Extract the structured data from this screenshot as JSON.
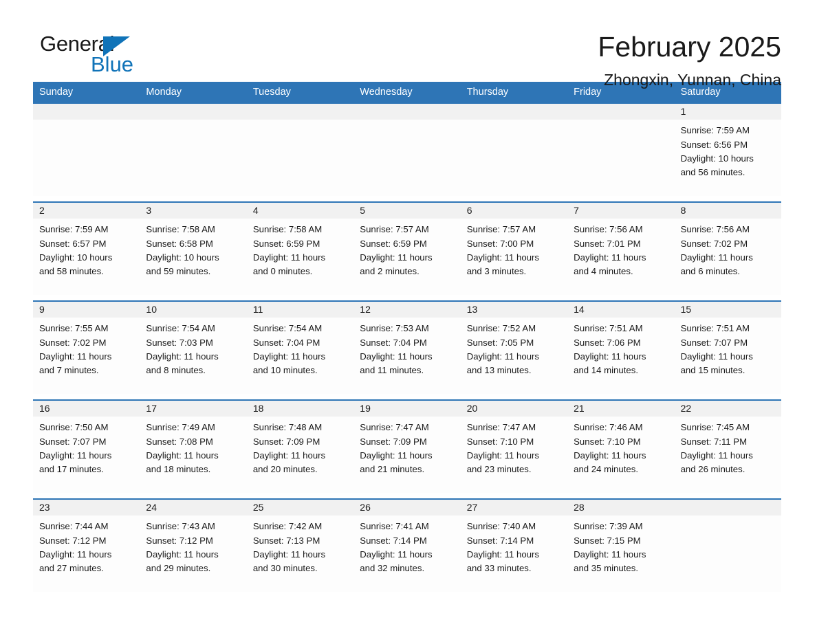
{
  "brand": {
    "name_part1": "General",
    "name_part2": "Blue",
    "accent_color": "#1073b8"
  },
  "header": {
    "month_title": "February 2025",
    "location": "Zhongxin, Yunnan, China"
  },
  "calendar": {
    "header_color": "#2e75b6",
    "weekdays": [
      "Sunday",
      "Monday",
      "Tuesday",
      "Wednesday",
      "Thursday",
      "Friday",
      "Saturday"
    ],
    "weeks": [
      [
        {
          "day": "",
          "lines": []
        },
        {
          "day": "",
          "lines": []
        },
        {
          "day": "",
          "lines": []
        },
        {
          "day": "",
          "lines": []
        },
        {
          "day": "",
          "lines": []
        },
        {
          "day": "",
          "lines": []
        },
        {
          "day": "1",
          "lines": [
            "Sunrise: 7:59 AM",
            "Sunset: 6:56 PM",
            "Daylight: 10 hours",
            "and 56 minutes."
          ]
        }
      ],
      [
        {
          "day": "2",
          "lines": [
            "Sunrise: 7:59 AM",
            "Sunset: 6:57 PM",
            "Daylight: 10 hours",
            "and 58 minutes."
          ]
        },
        {
          "day": "3",
          "lines": [
            "Sunrise: 7:58 AM",
            "Sunset: 6:58 PM",
            "Daylight: 10 hours",
            "and 59 minutes."
          ]
        },
        {
          "day": "4",
          "lines": [
            "Sunrise: 7:58 AM",
            "Sunset: 6:59 PM",
            "Daylight: 11 hours",
            "and 0 minutes."
          ]
        },
        {
          "day": "5",
          "lines": [
            "Sunrise: 7:57 AM",
            "Sunset: 6:59 PM",
            "Daylight: 11 hours",
            "and 2 minutes."
          ]
        },
        {
          "day": "6",
          "lines": [
            "Sunrise: 7:57 AM",
            "Sunset: 7:00 PM",
            "Daylight: 11 hours",
            "and 3 minutes."
          ]
        },
        {
          "day": "7",
          "lines": [
            "Sunrise: 7:56 AM",
            "Sunset: 7:01 PM",
            "Daylight: 11 hours",
            "and 4 minutes."
          ]
        },
        {
          "day": "8",
          "lines": [
            "Sunrise: 7:56 AM",
            "Sunset: 7:02 PM",
            "Daylight: 11 hours",
            "and 6 minutes."
          ]
        }
      ],
      [
        {
          "day": "9",
          "lines": [
            "Sunrise: 7:55 AM",
            "Sunset: 7:02 PM",
            "Daylight: 11 hours",
            "and 7 minutes."
          ]
        },
        {
          "day": "10",
          "lines": [
            "Sunrise: 7:54 AM",
            "Sunset: 7:03 PM",
            "Daylight: 11 hours",
            "and 8 minutes."
          ]
        },
        {
          "day": "11",
          "lines": [
            "Sunrise: 7:54 AM",
            "Sunset: 7:04 PM",
            "Daylight: 11 hours",
            "and 10 minutes."
          ]
        },
        {
          "day": "12",
          "lines": [
            "Sunrise: 7:53 AM",
            "Sunset: 7:04 PM",
            "Daylight: 11 hours",
            "and 11 minutes."
          ]
        },
        {
          "day": "13",
          "lines": [
            "Sunrise: 7:52 AM",
            "Sunset: 7:05 PM",
            "Daylight: 11 hours",
            "and 13 minutes."
          ]
        },
        {
          "day": "14",
          "lines": [
            "Sunrise: 7:51 AM",
            "Sunset: 7:06 PM",
            "Daylight: 11 hours",
            "and 14 minutes."
          ]
        },
        {
          "day": "15",
          "lines": [
            "Sunrise: 7:51 AM",
            "Sunset: 7:07 PM",
            "Daylight: 11 hours",
            "and 15 minutes."
          ]
        }
      ],
      [
        {
          "day": "16",
          "lines": [
            "Sunrise: 7:50 AM",
            "Sunset: 7:07 PM",
            "Daylight: 11 hours",
            "and 17 minutes."
          ]
        },
        {
          "day": "17",
          "lines": [
            "Sunrise: 7:49 AM",
            "Sunset: 7:08 PM",
            "Daylight: 11 hours",
            "and 18 minutes."
          ]
        },
        {
          "day": "18",
          "lines": [
            "Sunrise: 7:48 AM",
            "Sunset: 7:09 PM",
            "Daylight: 11 hours",
            "and 20 minutes."
          ]
        },
        {
          "day": "19",
          "lines": [
            "Sunrise: 7:47 AM",
            "Sunset: 7:09 PM",
            "Daylight: 11 hours",
            "and 21 minutes."
          ]
        },
        {
          "day": "20",
          "lines": [
            "Sunrise: 7:47 AM",
            "Sunset: 7:10 PM",
            "Daylight: 11 hours",
            "and 23 minutes."
          ]
        },
        {
          "day": "21",
          "lines": [
            "Sunrise: 7:46 AM",
            "Sunset: 7:10 PM",
            "Daylight: 11 hours",
            "and 24 minutes."
          ]
        },
        {
          "day": "22",
          "lines": [
            "Sunrise: 7:45 AM",
            "Sunset: 7:11 PM",
            "Daylight: 11 hours",
            "and 26 minutes."
          ]
        }
      ],
      [
        {
          "day": "23",
          "lines": [
            "Sunrise: 7:44 AM",
            "Sunset: 7:12 PM",
            "Daylight: 11 hours",
            "and 27 minutes."
          ]
        },
        {
          "day": "24",
          "lines": [
            "Sunrise: 7:43 AM",
            "Sunset: 7:12 PM",
            "Daylight: 11 hours",
            "and 29 minutes."
          ]
        },
        {
          "day": "25",
          "lines": [
            "Sunrise: 7:42 AM",
            "Sunset: 7:13 PM",
            "Daylight: 11 hours",
            "and 30 minutes."
          ]
        },
        {
          "day": "26",
          "lines": [
            "Sunrise: 7:41 AM",
            "Sunset: 7:14 PM",
            "Daylight: 11 hours",
            "and 32 minutes."
          ]
        },
        {
          "day": "27",
          "lines": [
            "Sunrise: 7:40 AM",
            "Sunset: 7:14 PM",
            "Daylight: 11 hours",
            "and 33 minutes."
          ]
        },
        {
          "day": "28",
          "lines": [
            "Sunrise: 7:39 AM",
            "Sunset: 7:15 PM",
            "Daylight: 11 hours",
            "and 35 minutes."
          ]
        },
        {
          "day": "",
          "lines": []
        }
      ]
    ]
  }
}
